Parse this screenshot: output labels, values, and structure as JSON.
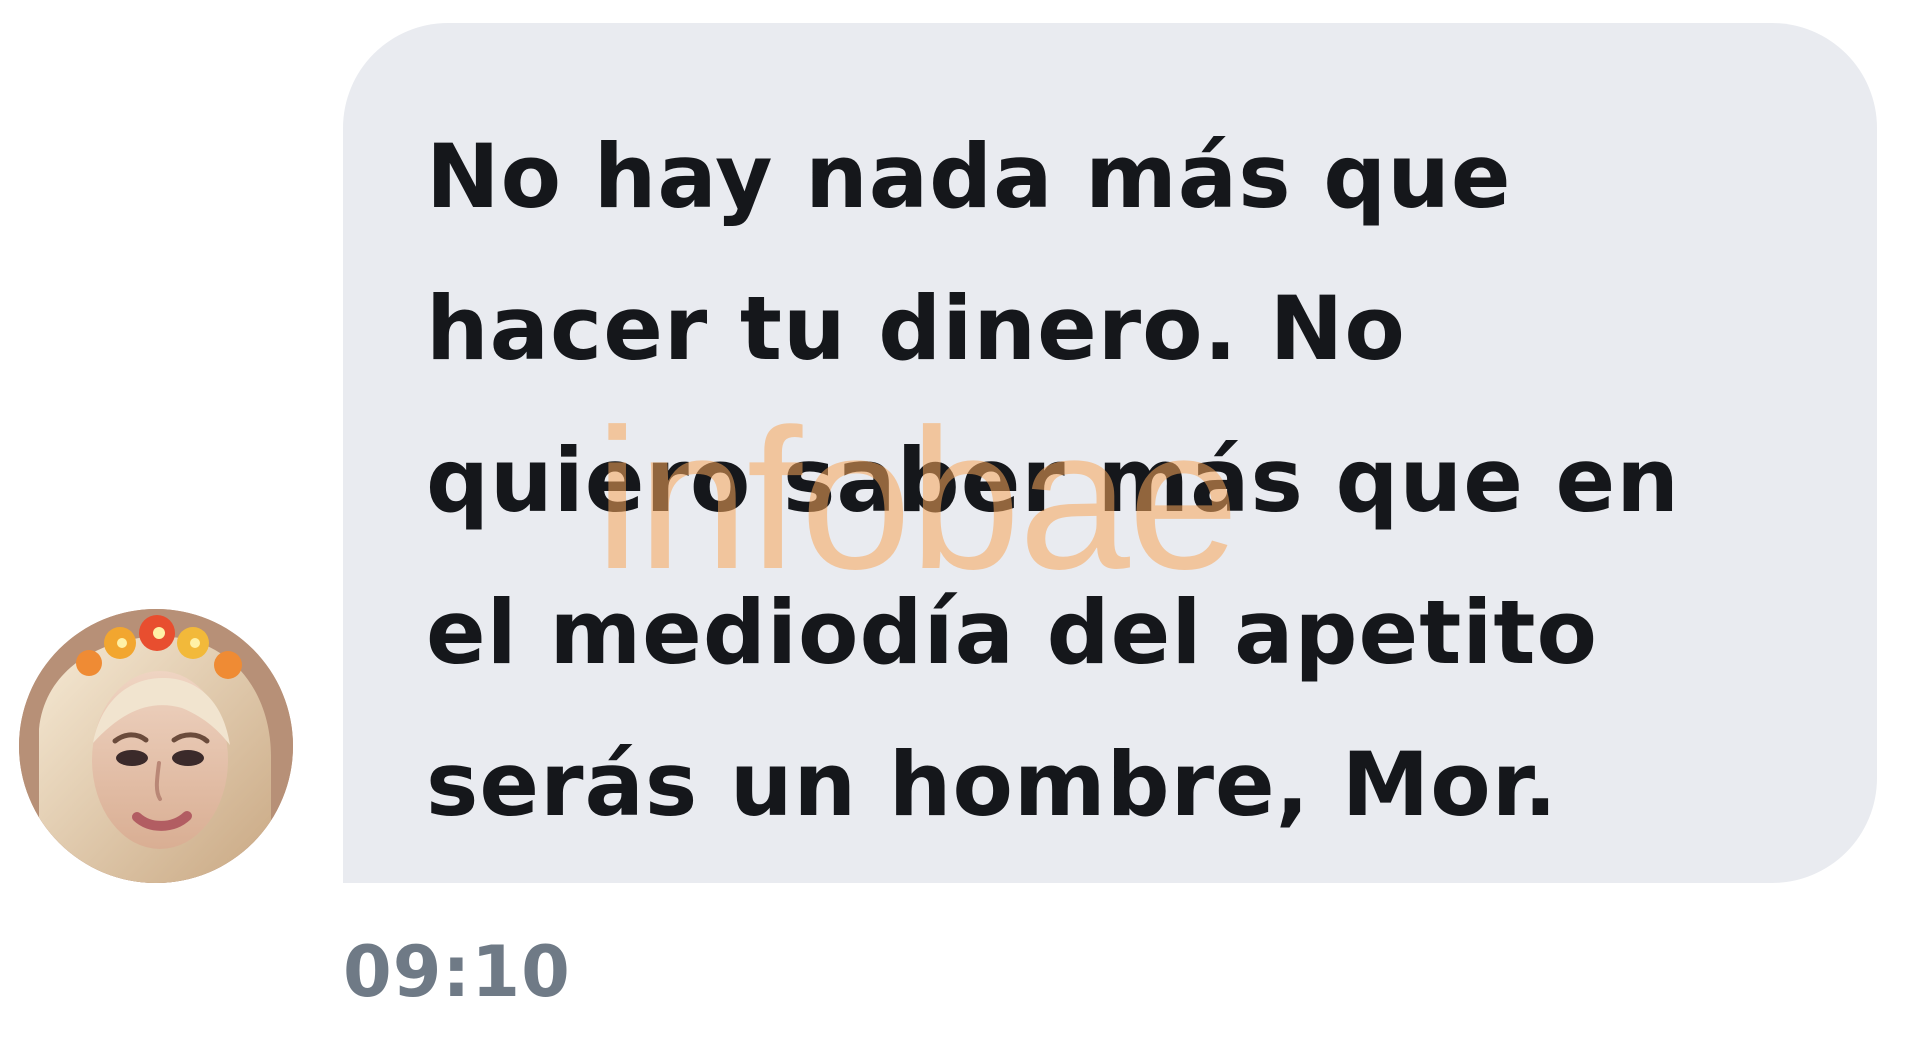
{
  "conversation": {
    "message": {
      "text": "No hay nada más que\nhacer tu dinero. No\nquiero saber más que en\nel mediodía del apetito\nserás un hombre, Mor.",
      "time": "09:10"
    },
    "watermark": "infobae",
    "avatar": {
      "icon": "contact-avatar"
    }
  },
  "colors": {
    "bubble_background": "#e9ebf0",
    "message_text": "#15171b",
    "timestamp": "#6f7a86",
    "watermark": "#f7a65a"
  }
}
